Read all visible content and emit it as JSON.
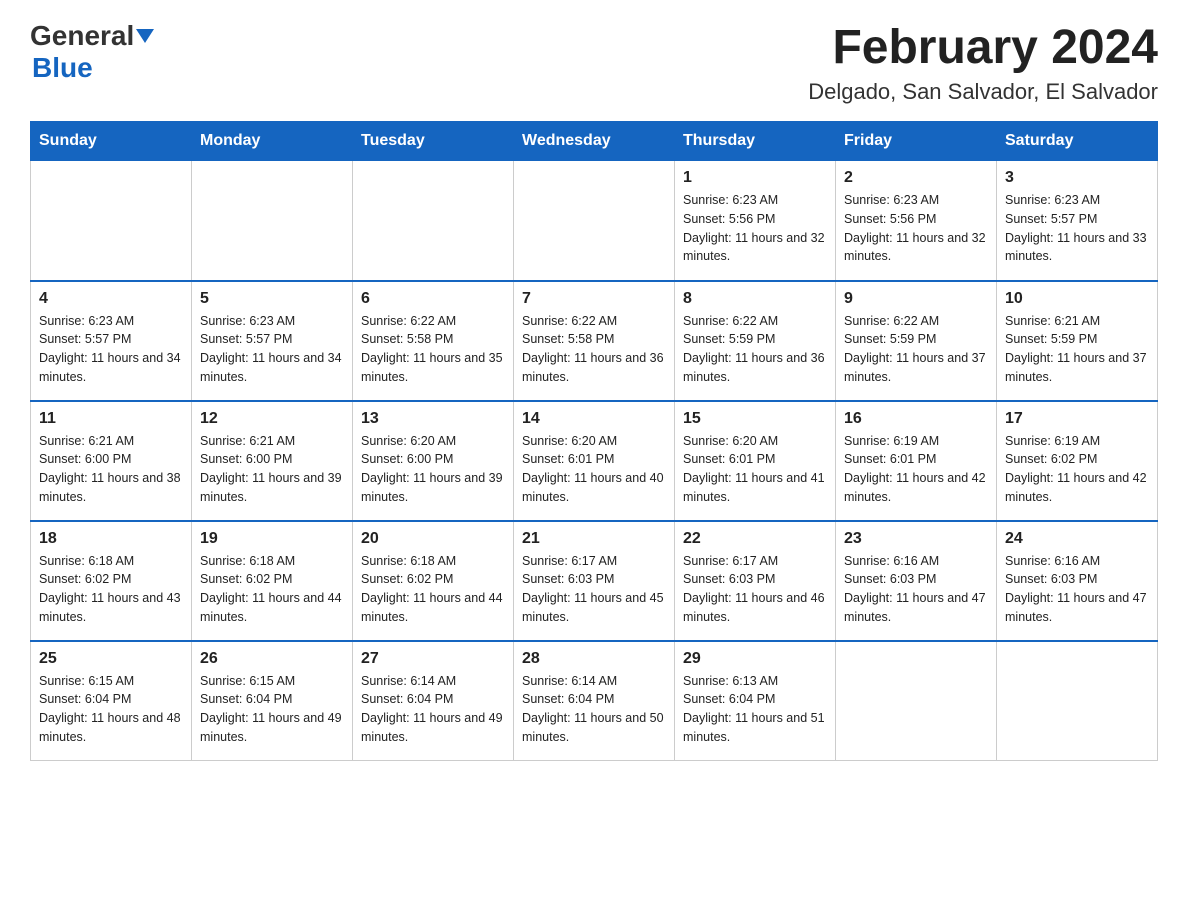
{
  "header": {
    "logo_text_general": "General",
    "logo_text_blue": "Blue",
    "month_title": "February 2024",
    "location": "Delgado, San Salvador, El Salvador"
  },
  "days_of_week": [
    "Sunday",
    "Monday",
    "Tuesday",
    "Wednesday",
    "Thursday",
    "Friday",
    "Saturday"
  ],
  "weeks": [
    [
      {
        "day": "",
        "info": ""
      },
      {
        "day": "",
        "info": ""
      },
      {
        "day": "",
        "info": ""
      },
      {
        "day": "",
        "info": ""
      },
      {
        "day": "1",
        "info": "Sunrise: 6:23 AM\nSunset: 5:56 PM\nDaylight: 11 hours and 32 minutes."
      },
      {
        "day": "2",
        "info": "Sunrise: 6:23 AM\nSunset: 5:56 PM\nDaylight: 11 hours and 32 minutes."
      },
      {
        "day": "3",
        "info": "Sunrise: 6:23 AM\nSunset: 5:57 PM\nDaylight: 11 hours and 33 minutes."
      }
    ],
    [
      {
        "day": "4",
        "info": "Sunrise: 6:23 AM\nSunset: 5:57 PM\nDaylight: 11 hours and 34 minutes."
      },
      {
        "day": "5",
        "info": "Sunrise: 6:23 AM\nSunset: 5:57 PM\nDaylight: 11 hours and 34 minutes."
      },
      {
        "day": "6",
        "info": "Sunrise: 6:22 AM\nSunset: 5:58 PM\nDaylight: 11 hours and 35 minutes."
      },
      {
        "day": "7",
        "info": "Sunrise: 6:22 AM\nSunset: 5:58 PM\nDaylight: 11 hours and 36 minutes."
      },
      {
        "day": "8",
        "info": "Sunrise: 6:22 AM\nSunset: 5:59 PM\nDaylight: 11 hours and 36 minutes."
      },
      {
        "day": "9",
        "info": "Sunrise: 6:22 AM\nSunset: 5:59 PM\nDaylight: 11 hours and 37 minutes."
      },
      {
        "day": "10",
        "info": "Sunrise: 6:21 AM\nSunset: 5:59 PM\nDaylight: 11 hours and 37 minutes."
      }
    ],
    [
      {
        "day": "11",
        "info": "Sunrise: 6:21 AM\nSunset: 6:00 PM\nDaylight: 11 hours and 38 minutes."
      },
      {
        "day": "12",
        "info": "Sunrise: 6:21 AM\nSunset: 6:00 PM\nDaylight: 11 hours and 39 minutes."
      },
      {
        "day": "13",
        "info": "Sunrise: 6:20 AM\nSunset: 6:00 PM\nDaylight: 11 hours and 39 minutes."
      },
      {
        "day": "14",
        "info": "Sunrise: 6:20 AM\nSunset: 6:01 PM\nDaylight: 11 hours and 40 minutes."
      },
      {
        "day": "15",
        "info": "Sunrise: 6:20 AM\nSunset: 6:01 PM\nDaylight: 11 hours and 41 minutes."
      },
      {
        "day": "16",
        "info": "Sunrise: 6:19 AM\nSunset: 6:01 PM\nDaylight: 11 hours and 42 minutes."
      },
      {
        "day": "17",
        "info": "Sunrise: 6:19 AM\nSunset: 6:02 PM\nDaylight: 11 hours and 42 minutes."
      }
    ],
    [
      {
        "day": "18",
        "info": "Sunrise: 6:18 AM\nSunset: 6:02 PM\nDaylight: 11 hours and 43 minutes."
      },
      {
        "day": "19",
        "info": "Sunrise: 6:18 AM\nSunset: 6:02 PM\nDaylight: 11 hours and 44 minutes."
      },
      {
        "day": "20",
        "info": "Sunrise: 6:18 AM\nSunset: 6:02 PM\nDaylight: 11 hours and 44 minutes."
      },
      {
        "day": "21",
        "info": "Sunrise: 6:17 AM\nSunset: 6:03 PM\nDaylight: 11 hours and 45 minutes."
      },
      {
        "day": "22",
        "info": "Sunrise: 6:17 AM\nSunset: 6:03 PM\nDaylight: 11 hours and 46 minutes."
      },
      {
        "day": "23",
        "info": "Sunrise: 6:16 AM\nSunset: 6:03 PM\nDaylight: 11 hours and 47 minutes."
      },
      {
        "day": "24",
        "info": "Sunrise: 6:16 AM\nSunset: 6:03 PM\nDaylight: 11 hours and 47 minutes."
      }
    ],
    [
      {
        "day": "25",
        "info": "Sunrise: 6:15 AM\nSunset: 6:04 PM\nDaylight: 11 hours and 48 minutes."
      },
      {
        "day": "26",
        "info": "Sunrise: 6:15 AM\nSunset: 6:04 PM\nDaylight: 11 hours and 49 minutes."
      },
      {
        "day": "27",
        "info": "Sunrise: 6:14 AM\nSunset: 6:04 PM\nDaylight: 11 hours and 49 minutes."
      },
      {
        "day": "28",
        "info": "Sunrise: 6:14 AM\nSunset: 6:04 PM\nDaylight: 11 hours and 50 minutes."
      },
      {
        "day": "29",
        "info": "Sunrise: 6:13 AM\nSunset: 6:04 PM\nDaylight: 11 hours and 51 minutes."
      },
      {
        "day": "",
        "info": ""
      },
      {
        "day": "",
        "info": ""
      }
    ]
  ]
}
